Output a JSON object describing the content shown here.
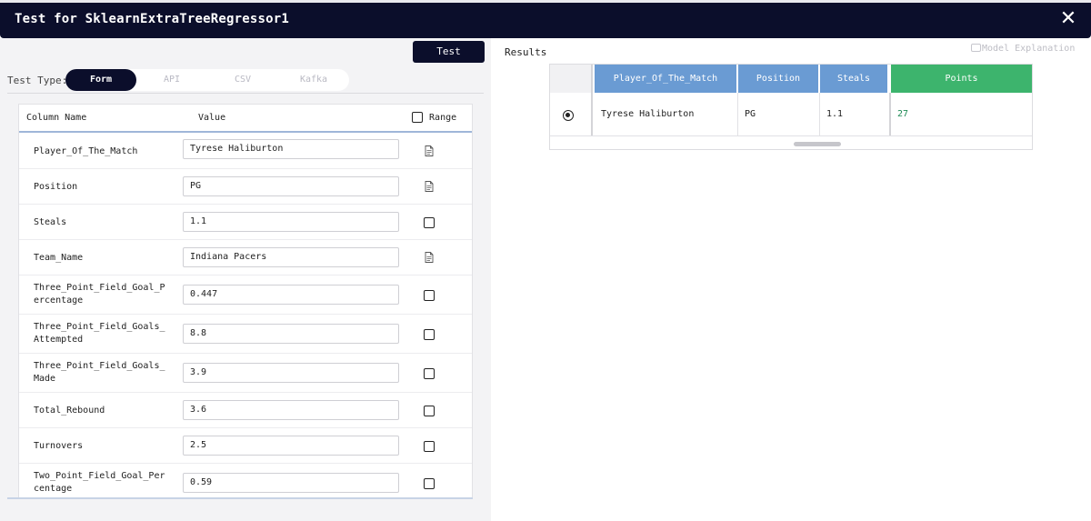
{
  "window": {
    "title": "Test for SklearnExtraTreeRegressor1"
  },
  "toolbar": {
    "test_label": "Test"
  },
  "test_type": {
    "label": "Test Type:",
    "tabs": [
      {
        "label": "Form",
        "active": true
      },
      {
        "label": "API",
        "active": false
      },
      {
        "label": "CSV",
        "active": false
      },
      {
        "label": "Kafka",
        "active": false
      }
    ]
  },
  "form": {
    "headers": {
      "column_name": "Column Name",
      "value": "Value",
      "range": "Range"
    },
    "rows": [
      {
        "name": "Player_Of_The_Match",
        "value": "Tyrese Haliburton",
        "control": "document-icon"
      },
      {
        "name": "Position",
        "value": "PG",
        "control": "document-icon"
      },
      {
        "name": "Steals",
        "value": "1.1",
        "control": "checkbox"
      },
      {
        "name": "Team_Name",
        "value": "Indiana Pacers",
        "control": "document-icon"
      },
      {
        "name": "Three_Point_Field_Goal_Percentage",
        "value": "0.447",
        "control": "checkbox"
      },
      {
        "name": "Three_Point_Field_Goals_Attempted",
        "value": "8.8",
        "control": "checkbox"
      },
      {
        "name": "Three_Point_Field_Goals_Made",
        "value": "3.9",
        "control": "checkbox"
      },
      {
        "name": "Total_Rebound",
        "value": "3.6",
        "control": "checkbox"
      },
      {
        "name": "Turnovers",
        "value": "2.5",
        "control": "checkbox"
      },
      {
        "name": "Two_Point_Field_Goal_Percentage",
        "value": "0.59",
        "control": "checkbox"
      }
    ]
  },
  "results": {
    "label": "Results",
    "model_explanation": "Model Explanation",
    "columns": [
      "Player_Of_The_Match",
      "Position",
      "Steals",
      "Points"
    ],
    "rows": [
      {
        "selected": true,
        "cells": [
          "Tyrese Haliburton",
          "PG",
          "1.1",
          "27"
        ]
      }
    ]
  },
  "colors": {
    "title_bar": "#0b0e2b",
    "feature_header": "#6a9bd3",
    "target_header": "#3db46d",
    "target_value": "#1e8a55"
  }
}
